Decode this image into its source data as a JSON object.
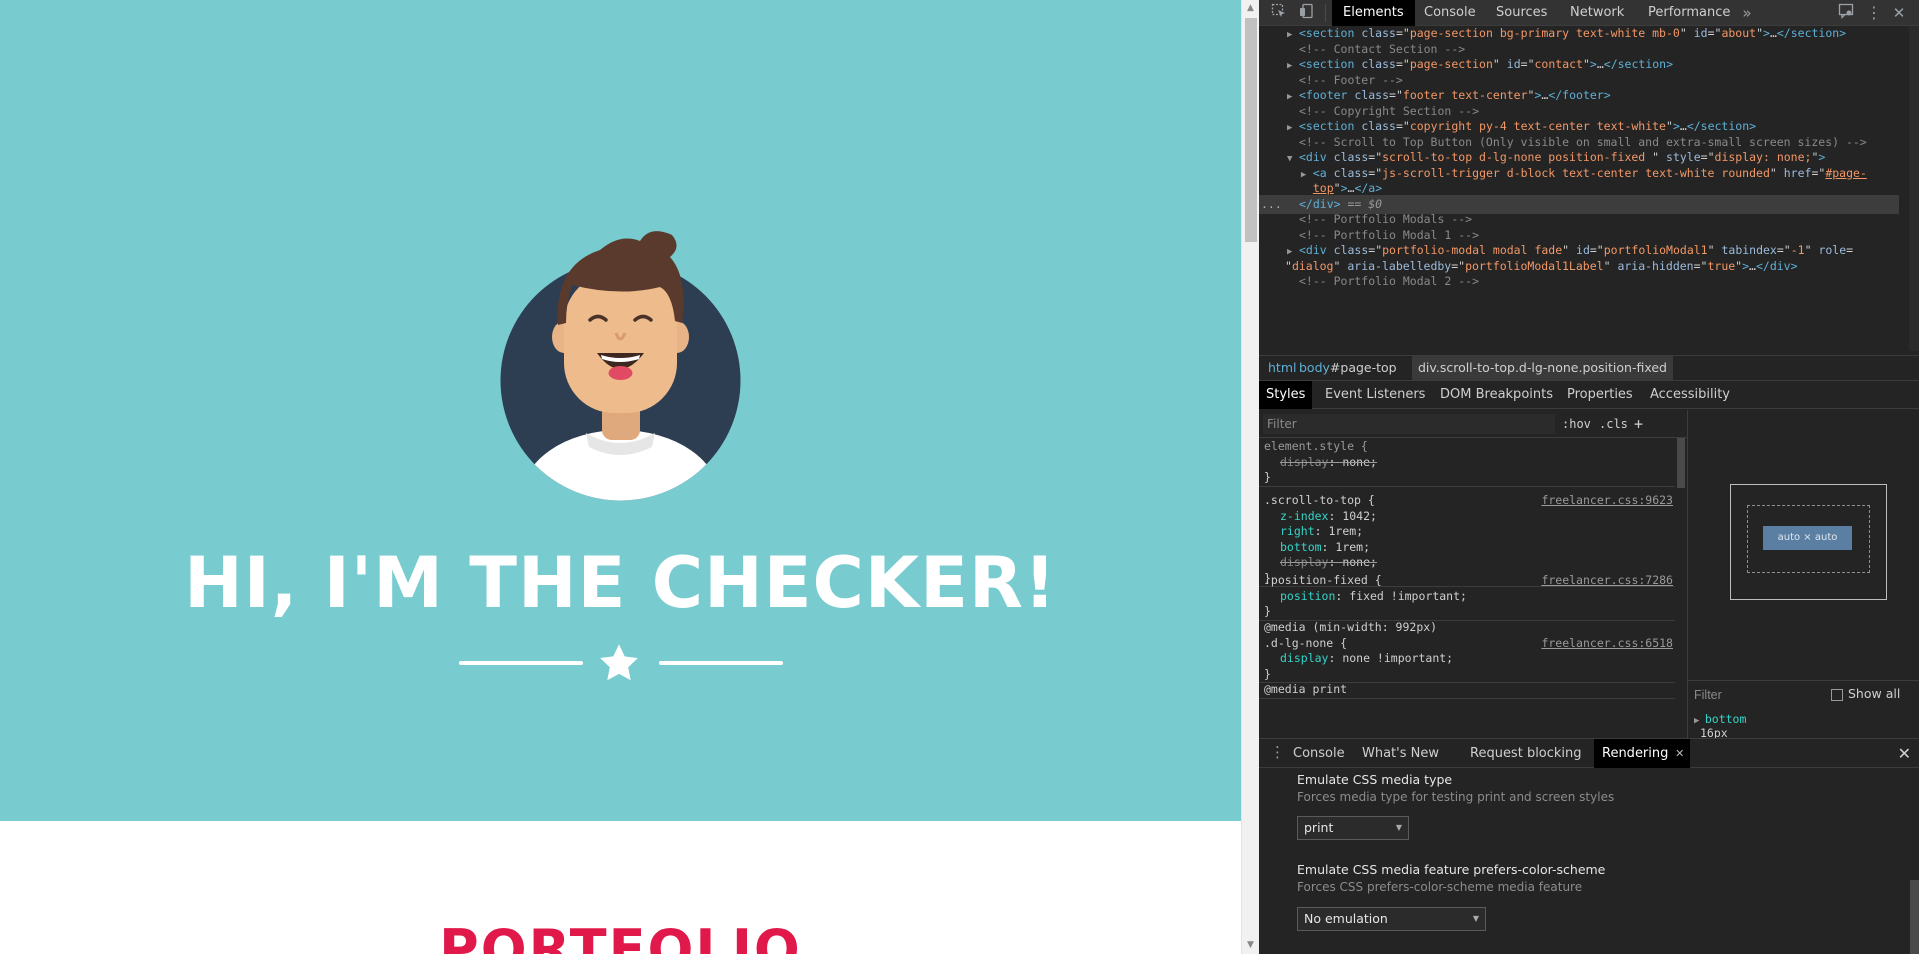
{
  "page": {
    "hero_title": "HI, I'M THE CHECKER!",
    "portfolio_heading": "PORTFOLIO",
    "colors": {
      "masthead": "#78ccd0",
      "avatar_bg": "#2e3e52",
      "portfolio": "#e0194a"
    }
  },
  "devtools": {
    "tabs": [
      "Elements",
      "Console",
      "Sources",
      "Network",
      "Performance"
    ],
    "more_tabs_icon": "chevron-double-right-icon",
    "dom": {
      "lines": [
        {
          "html": "<span class=\"tri\">▶</span><span class=\"tag\">&lt;section</span> <span class=\"attr\">class</span><span class=\"plain\">=\"</span><span class=\"aval\">page-section bg-primary text-white mb-0</span><span class=\"plain\">\"</span> <span class=\"attr\">id</span><span class=\"plain\">=\"</span><span class=\"aval\">about</span><span class=\"plain\">\"</span><span class=\"tag\">&gt;</span><span class=\"plain\">…</span><span class=\"tag\">&lt;/section&gt;</span>"
        },
        {
          "html": "<span class=\"tri\"></span><span class=\"cmt\">&lt;!-- Contact Section --&gt;</span>"
        },
        {
          "html": "<span class=\"tri\">▶</span><span class=\"tag\">&lt;section</span> <span class=\"attr\">class</span><span class=\"plain\">=\"</span><span class=\"aval\">page-section</span><span class=\"plain\">\"</span> <span class=\"attr\">id</span><span class=\"plain\">=\"</span><span class=\"aval\">contact</span><span class=\"plain\">\"</span><span class=\"tag\">&gt;</span><span class=\"plain\">…</span><span class=\"tag\">&lt;/section&gt;</span>"
        },
        {
          "html": "<span class=\"tri\"></span><span class=\"cmt\">&lt;!-- Footer --&gt;</span>"
        },
        {
          "html": "<span class=\"tri\">▶</span><span class=\"tag\">&lt;footer</span> <span class=\"attr\">class</span><span class=\"plain\">=\"</span><span class=\"aval\">footer text-center</span><span class=\"plain\">\"</span><span class=\"tag\">&gt;</span><span class=\"plain\">…</span><span class=\"tag\">&lt;/footer&gt;</span>"
        },
        {
          "html": "<span class=\"tri\"></span><span class=\"cmt\">&lt;!-- Copyright Section --&gt;</span>"
        },
        {
          "html": "<span class=\"tri\">▶</span><span class=\"tag\">&lt;section</span> <span class=\"attr\">class</span><span class=\"plain\">=\"</span><span class=\"aval\">copyright py-4 text-center text-white</span><span class=\"plain\">\"</span><span class=\"tag\">&gt;</span><span class=\"plain\">…</span><span class=\"tag\">&lt;/section&gt;</span>"
        },
        {
          "html": "<span class=\"tri\"></span><span class=\"cmt\">&lt;!-- Scroll to Top Button (Only visible on small and extra-small screen sizes) --&gt;</span>"
        },
        {
          "html": "<span class=\"tri\">▼</span><span class=\"tag\">&lt;div</span> <span class=\"attr\">class</span><span class=\"plain\">=\"</span><span class=\"aval\">scroll-to-top d-lg-none position-fixed </span><span class=\"plain\">\"</span> <span class=\"attr\">style</span><span class=\"plain\">=\"</span><span class=\"aval\">display: none;</span><span class=\"plain\">\"</span><span class=\"tag\">&gt;</span>"
        },
        {
          "html": "  <span class=\"tri\">▶</span><span class=\"tag\">&lt;a</span> <span class=\"attr\">class</span><span class=\"plain\">=\"</span><span class=\"aval\">js-scroll-trigger d-block text-center text-white rounded</span><span class=\"plain\">\"</span> <span class=\"attr\">href</span><span class=\"plain\">=\"</span><span class=\"aval\" style=\"text-decoration:underline\">#page-</span>"
        },
        {
          "html": "  <span class=\"tri\"></span><span class=\"aval\" style=\"text-decoration:underline\">top</span><span class=\"plain\">\"</span><span class=\"tag\">&gt;</span><span class=\"plain\">…</span><span class=\"tag\">&lt;/a&gt;</span>"
        },
        {
          "html": "<span class=\"tri\"></span><span class=\"tag\">&lt;/div&gt;</span> <span class=\"dollar\">== $0</span>",
          "selected": true
        },
        {
          "html": "<span class=\"tri\"></span><span class=\"cmt\">&lt;!-- Portfolio Modals --&gt;</span>"
        },
        {
          "html": "<span class=\"tri\"></span><span class=\"cmt\">&lt;!-- Portfolio Modal 1 --&gt;</span>"
        },
        {
          "html": "<span class=\"tri\">▶</span><span class=\"tag\">&lt;div</span> <span class=\"attr\">class</span><span class=\"plain\">=\"</span><span class=\"aval\">portfolio-modal modal fade</span><span class=\"plain\">\"</span> <span class=\"attr\">id</span><span class=\"plain\">=\"</span><span class=\"aval\">portfolioModal1</span><span class=\"plain\">\"</span> <span class=\"attr\">tabindex</span><span class=\"plain\">=\"</span><span class=\"aval\">-1</span><span class=\"plain\">\"</span> <span class=\"attr\">role</span><span class=\"plain\">=</span>"
        },
        {
          "html": "<span class=\"plain\">\"</span><span class=\"aval\">dialog</span><span class=\"plain\">\"</span> <span class=\"attr\">aria-labelledby</span><span class=\"plain\">=\"</span><span class=\"aval\">portfolioModal1Label</span><span class=\"plain\">\"</span> <span class=\"attr\">aria-hidden</span><span class=\"plain\">=\"</span><span class=\"aval\">true</span><span class=\"plain\">\"</span><span class=\"tag\">&gt;</span><span class=\"plain\">…</span><span class=\"tag\">&lt;/div&gt;</span>"
        },
        {
          "html": "<span class=\"tri\"></span><span class=\"cmt\">&lt;!-- Portfolio Modal 2 --&gt;</span>"
        }
      ],
      "ellipsis": "..."
    },
    "breadcrumbs": [
      {
        "tag": "html",
        "rest": ""
      },
      {
        "tag": "body",
        "rest": "#page-top"
      },
      {
        "tag": "div",
        "rest": ".scroll-to-top.d-lg-none.position-fixed"
      }
    ],
    "sub_tabs": [
      "Styles",
      "Event Listeners",
      "DOM Breakpoints",
      "Properties",
      "Accessibility"
    ],
    "styles": {
      "filter_placeholder": "Filter",
      "hov": ":hov",
      "cls": ".cls",
      "add": "+",
      "rules": [
        {
          "selector": "element.style {",
          "dim": true,
          "source": "",
          "props": [
            {
              "name": "display",
              "value": "none;",
              "struck": true
            }
          ]
        },
        {
          "selector": ".scroll-to-top {",
          "source": "freelancer.css:9623",
          "props": [
            {
              "name": "z-index",
              "value": "1042;"
            },
            {
              "name": "right",
              "value": "1rem;"
            },
            {
              "name": "bottom",
              "value": "1rem;"
            },
            {
              "name": "display",
              "value": "none;",
              "struck": true
            }
          ]
        },
        {
          "selector": ".position-fixed {",
          "source": "freelancer.css:7286",
          "props": [
            {
              "name": "position",
              "value": "fixed !important;"
            }
          ]
        },
        {
          "selector": "@media (min-width: 992px)",
          "selector2": ".d-lg-none {",
          "source": "freelancer.css:6518",
          "props": [
            {
              "name": "display",
              "value": "none !important;"
            }
          ]
        },
        {
          "selector": "@media print",
          "source": "",
          "props": []
        }
      ]
    },
    "computed": {
      "box_content": "auto × auto",
      "filter_placeholder": "Filter",
      "show_all": "Show all",
      "prop_name": "bottom",
      "prop_value": "16px"
    },
    "drawer": {
      "tabs": [
        "Console",
        "What's New",
        "Request blocking",
        "Rendering"
      ],
      "active": "Rendering",
      "rendering": {
        "media_type_title": "Emulate CSS media type",
        "media_type_desc": "Forces media type for testing print and screen styles",
        "media_type_value": "print",
        "color_scheme_title": "Emulate CSS media feature prefers-color-scheme",
        "color_scheme_desc": "Forces CSS prefers-color-scheme media feature",
        "color_scheme_value": "No emulation"
      }
    }
  }
}
